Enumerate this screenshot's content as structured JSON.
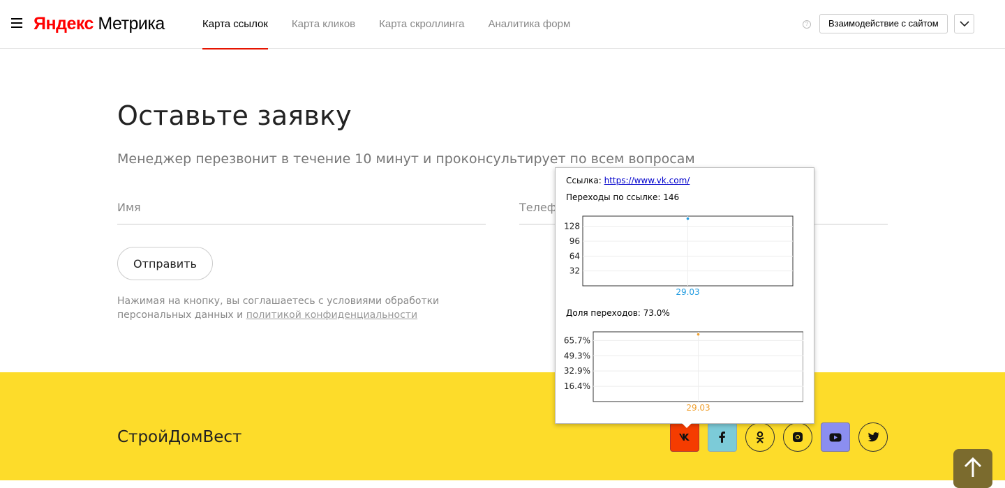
{
  "logo": {
    "brand": "Яндекс",
    "product": "Метрика"
  },
  "tabs": [
    {
      "label": "Карта ссылок",
      "active": true
    },
    {
      "label": "Карта кликов",
      "active": false
    },
    {
      "label": "Карта скроллинга",
      "active": false
    },
    {
      "label": "Аналитика форм",
      "active": false
    }
  ],
  "header": {
    "help_glyph": "?",
    "interact_label": "Взаимодействие с сайтом"
  },
  "form": {
    "title": "Оставьте заявку",
    "subtitle": "Менеджер перезвонит в течение 10 минут и проконсультирует по всем вопросам",
    "name_placeholder": "Имя",
    "phone_placeholder": "Телефон",
    "submit_label": "Отправить",
    "consent_text": "Нажимая на кнопку, вы соглашаетесь с условиями обработки персональных данных и ",
    "consent_link": "политикой конфиденциальности"
  },
  "footer": {
    "brand": "СтройДомВест",
    "social": [
      "vk-icon",
      "facebook-icon",
      "odnoklassniki-icon",
      "instagram-icon",
      "youtube-icon",
      "twitter-icon"
    ]
  },
  "tooltip": {
    "link_label": "Ссылка: ",
    "link_url": "https://www.vk.com/",
    "clicks_label": "Переходы по ссылке: 146",
    "share_label": "Доля переходов: 73.0%"
  },
  "chart_data": [
    {
      "type": "scatter",
      "x": [
        "29.03"
      ],
      "series": [
        {
          "values": [
            146
          ],
          "color": "#1e9ae0"
        }
      ],
      "yticks": [
        32,
        64,
        96,
        128
      ],
      "ylim": [
        0,
        150
      ],
      "grid": true
    },
    {
      "type": "scatter",
      "x": [
        "29.03"
      ],
      "series": [
        {
          "values": [
            73.0
          ],
          "color": "#f0a030"
        }
      ],
      "yticks": [
        "16.4%",
        "32.9%",
        "49.3%",
        "65.7%"
      ],
      "ylim": [
        0,
        75
      ],
      "grid": true
    }
  ],
  "colors": {
    "accent_red": "#e61400",
    "footer_yellow": "#fddc2a",
    "series_blue": "#1e9ae0",
    "series_orange": "#f0a030"
  }
}
